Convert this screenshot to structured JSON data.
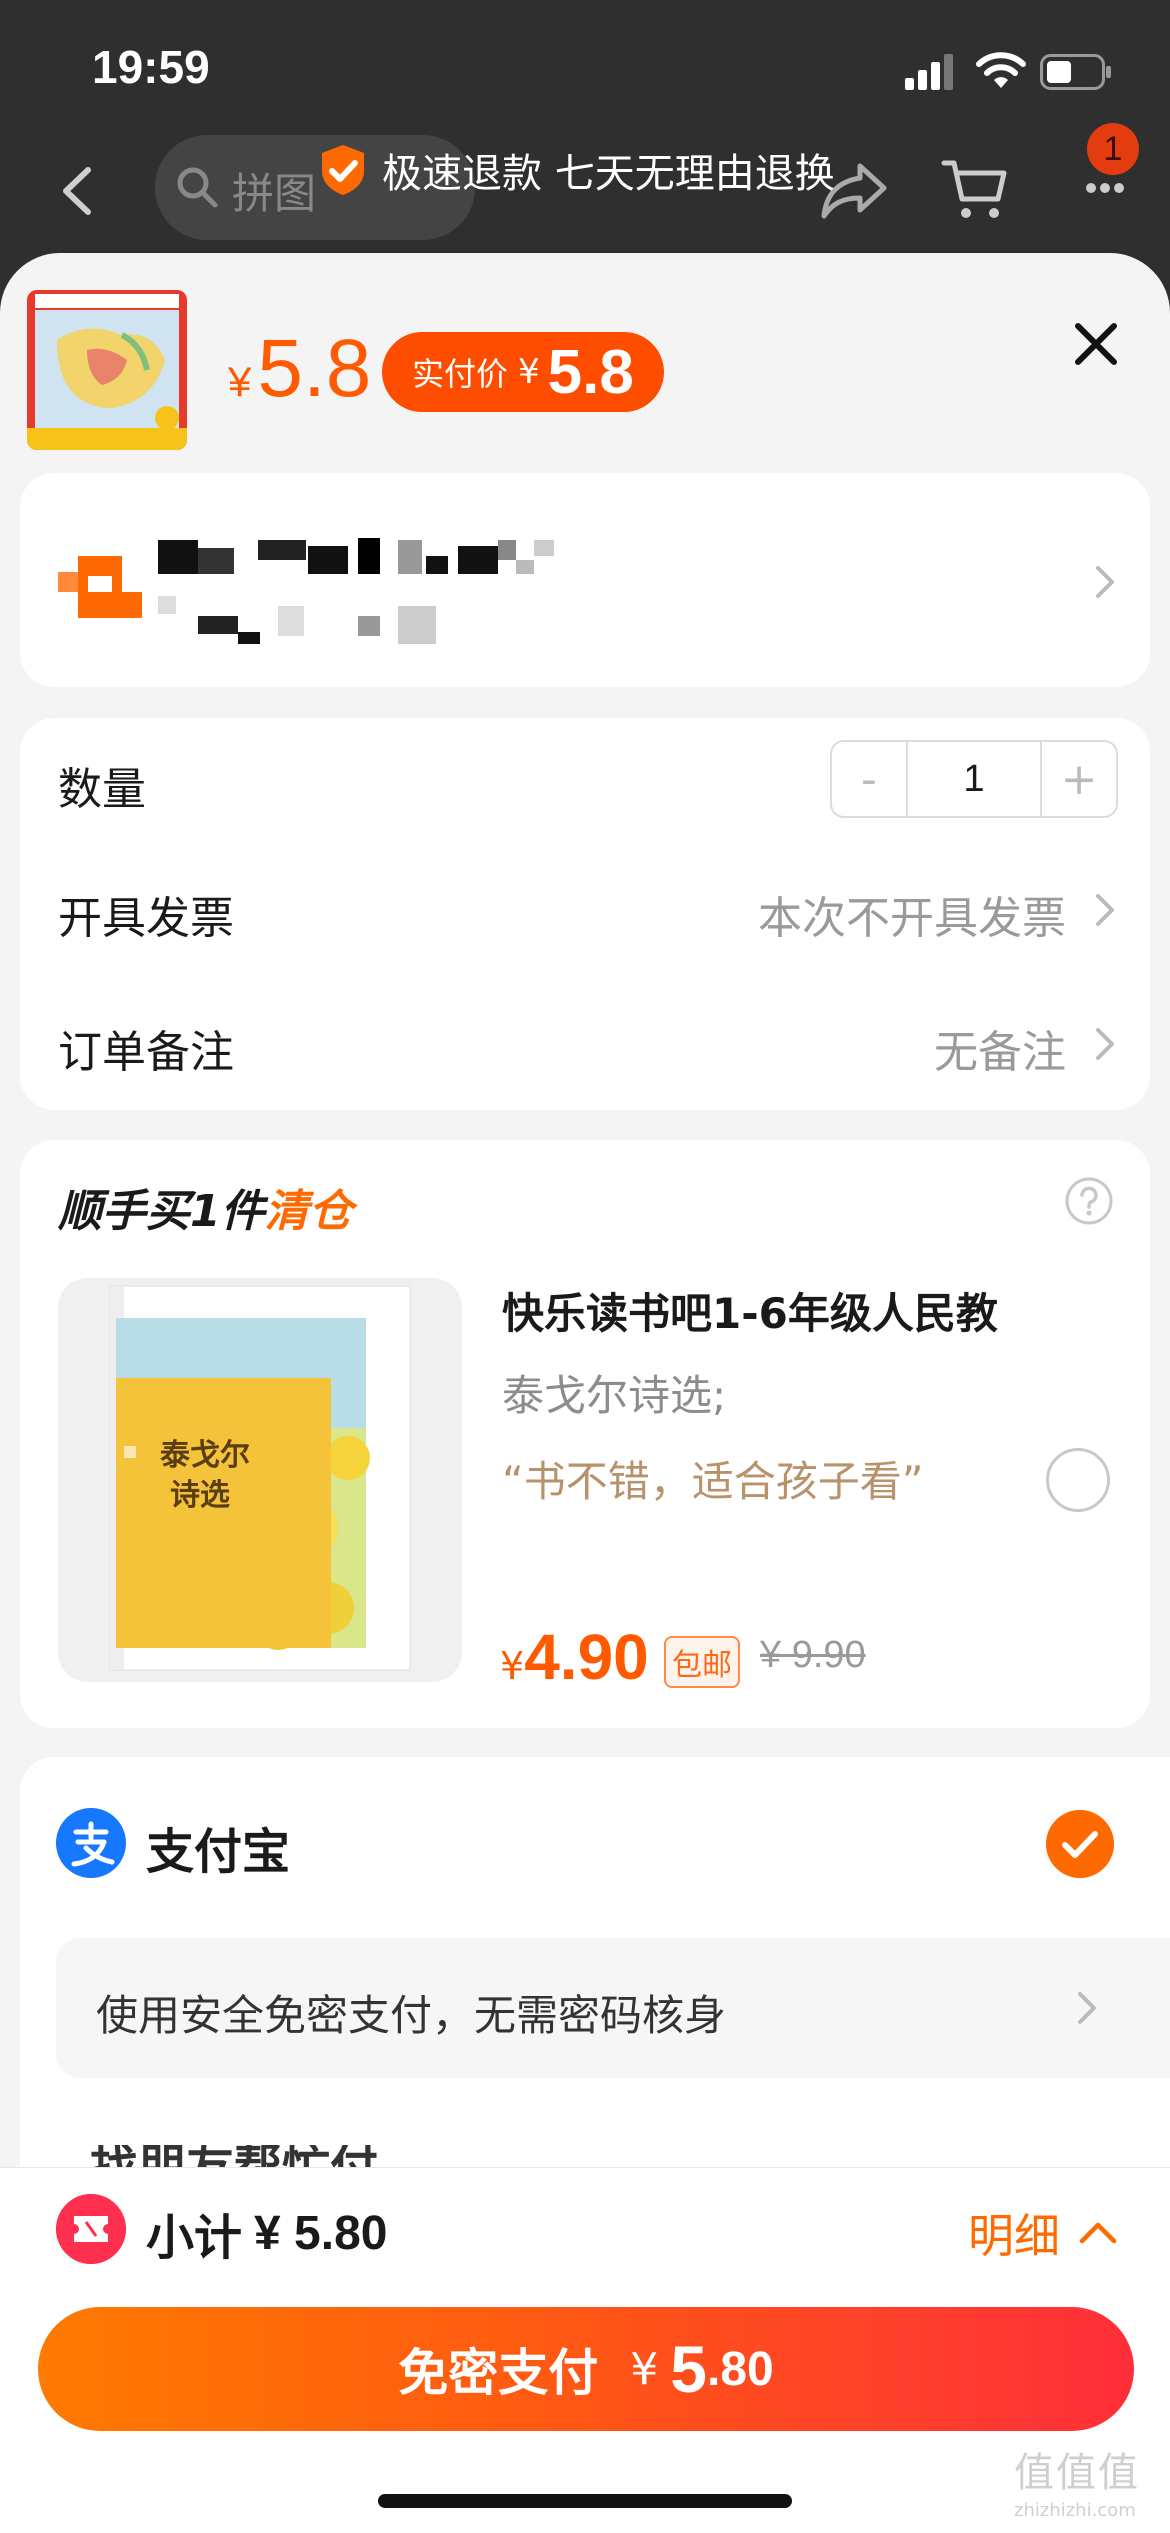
{
  "status_bar": {
    "time": "19:59"
  },
  "header": {
    "search_placeholder": "拼图",
    "refund_banner": "极速退款 七天无理由退换",
    "cart_badge": "1"
  },
  "sheet": {
    "price_symbol": "¥",
    "price": "5.8",
    "pay_pill_label": "实付价",
    "pay_pill_symbol": "¥",
    "pay_pill_value": "5.8"
  },
  "options": {
    "quantity_label": "数量",
    "quantity_value": "1",
    "minus": "-",
    "plus": "+",
    "invoice_label": "开具发票",
    "invoice_value": "本次不开具发票",
    "remark_label": "订单备注",
    "remark_value": "无备注"
  },
  "upsell": {
    "title_prefix": "顺手买1件",
    "title_tag": "清仓",
    "product_name": "快乐读书吧1-6年级人民教",
    "product_sub": "泰戈尔诗选;",
    "product_quote": "“书不错，适合孩子看”",
    "price_symbol": "¥",
    "price": "4.90",
    "shipping_tag": "包邮",
    "original_price": "¥ 9.90",
    "book_title_1": "泰戈尔",
    "book_title_2": "诗选",
    "book_spine": "泰戈尔诗选"
  },
  "payment": {
    "method": "支付宝",
    "note": "使用安全免密支付，无需密码核身",
    "next_method_cut": "找朋友帮忙付"
  },
  "footer": {
    "subtotal_label": "小计",
    "subtotal_value": "¥ 5.80",
    "detail_label": "明细",
    "pay_button_label": "免密支付",
    "pay_symbol": "¥",
    "pay_int": "5",
    "pay_dec": ".80"
  },
  "watermark": {
    "line1": "值值值",
    "line2": "zhizhizhi.com"
  },
  "colors": {
    "accent": "#ff5a00",
    "pay_gradient_end": "#ff2e3a",
    "alipay_blue": "#1677ff",
    "coupon_red": "#ff2f4f"
  }
}
